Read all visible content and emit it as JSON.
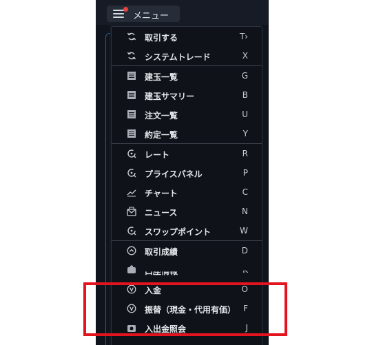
{
  "header": {
    "menu_label": "メニュー"
  },
  "menu": {
    "groups": [
      {
        "items": [
          {
            "label": "取引する",
            "key": "T›",
            "icon": "refresh-icon"
          },
          {
            "label": "システムトレード",
            "key": "X",
            "icon": "refresh-icon"
          }
        ]
      },
      {
        "items": [
          {
            "label": "建玉一覧",
            "key": "G",
            "icon": "list-icon"
          },
          {
            "label": "建玉サマリー",
            "key": "B",
            "icon": "list-icon"
          },
          {
            "label": "注文一覧",
            "key": "U",
            "icon": "list-icon"
          },
          {
            "label": "約定一覧",
            "key": "Y",
            "icon": "list-icon"
          }
        ]
      },
      {
        "items": [
          {
            "label": "レート",
            "key": "R",
            "icon": "rate-icon"
          },
          {
            "label": "プライスパネル",
            "key": "P",
            "icon": "rate-icon"
          },
          {
            "label": "チャート",
            "key": "C",
            "icon": "chart-icon"
          },
          {
            "label": "ニュース",
            "key": "N",
            "icon": "news-icon"
          },
          {
            "label": "スワップポイント",
            "key": "W",
            "icon": "rate-icon"
          }
        ]
      },
      {
        "items": [
          {
            "label": "取引成績",
            "key": "D",
            "icon": "up-circle-icon"
          },
          {
            "label": "口座情報",
            "key": "K",
            "icon": "account-icon"
          },
          {
            "label": "入金",
            "key": "O",
            "icon": "v-circle-icon"
          },
          {
            "label": "振替（現金・代用有価）",
            "key": "F",
            "icon": "v-circle-icon"
          },
          {
            "label": "入出金照会",
            "key": "J",
            "icon": "camera-icon"
          }
        ]
      }
    ]
  }
}
